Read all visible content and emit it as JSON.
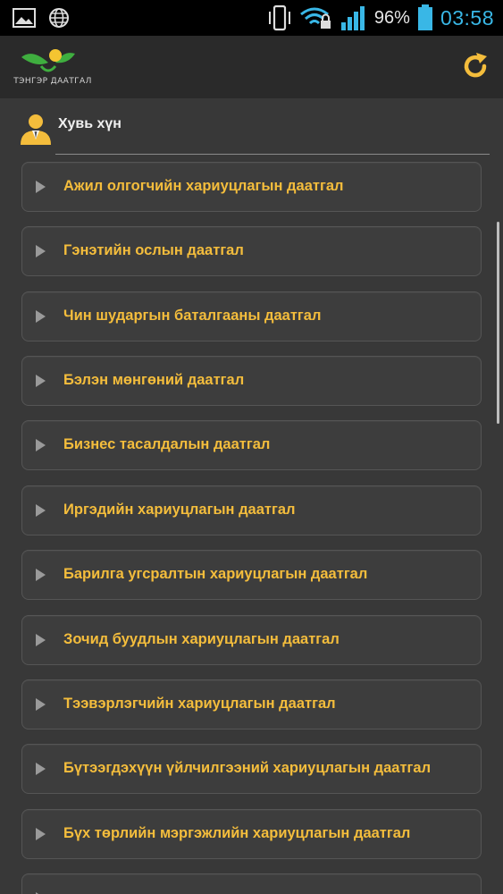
{
  "status_bar": {
    "battery_percent": "96%",
    "time": "03:58",
    "icons": [
      "image-icon",
      "globe-icon",
      "vibrate-icon",
      "wifi-lock-icon",
      "signal-icon",
      "battery-icon"
    ]
  },
  "app_bar": {
    "logo_text": "ТЭНГЭР ДААТГАЛ",
    "refresh_icon": "refresh-icon",
    "accent_color": "#f4bd3c"
  },
  "section": {
    "title": "Хувь хүн",
    "icon": "person-icon"
  },
  "items": [
    {
      "label": "Ажил олгогчийн хариуцлагын даатгал"
    },
    {
      "label": "Гэнэтийн ослын даатгал"
    },
    {
      "label": "Чин шударгын баталгааны даатгал"
    },
    {
      "label": "Бэлэн мөнгөний даатгал"
    },
    {
      "label": "Бизнес тасалдалын даатгал"
    },
    {
      "label": "Иргэдийн хариуцлагын даатгал"
    },
    {
      "label": "Барилга угсралтын хариуцлагын даатгал"
    },
    {
      "label": "Зочид буудлын хариуцлагын даатгал"
    },
    {
      "label": "Тээвэрлэгчийн хариуцлагын даатгал"
    },
    {
      "label": "Бүтээгдэхүүн үйлчилгээний хариуцлагын даатгал"
    },
    {
      "label": "Бүх төрлийн мэргэжлийн хариуцлагын даатгал"
    },
    {
      "label": ""
    }
  ]
}
